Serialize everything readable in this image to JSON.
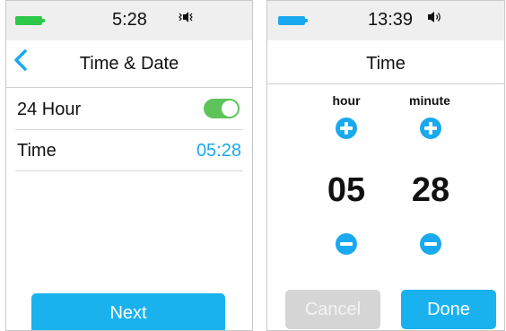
{
  "colors": {
    "accent": "#1aa9ee",
    "battery": "#2bc84a",
    "battery_right": "#1aa9ee",
    "toggle_on": "#5dc35a",
    "cancel_disabled": "#d5d5d5"
  },
  "left_screen": {
    "status": {
      "time": "5:28",
      "battery_icon": "battery-icon",
      "sound_icon": "speaker-muted-icon"
    },
    "header": {
      "title": "Time & Date",
      "back_icon": "chevron-left-icon"
    },
    "rows": [
      {
        "label": "24 Hour",
        "control": "toggle",
        "toggle_on": true
      },
      {
        "label": "Time",
        "value": "05:28"
      }
    ],
    "next_label": "Next"
  },
  "right_screen": {
    "status": {
      "time": "13:39",
      "battery_icon": "battery-icon",
      "sound_icon": "speaker-on-icon"
    },
    "header": {
      "title": "Time"
    },
    "hour": {
      "label": "hour",
      "value": "05"
    },
    "minute": {
      "label": "minute",
      "value": "28"
    },
    "cancel_label": "Cancel",
    "done_label": "Done"
  }
}
